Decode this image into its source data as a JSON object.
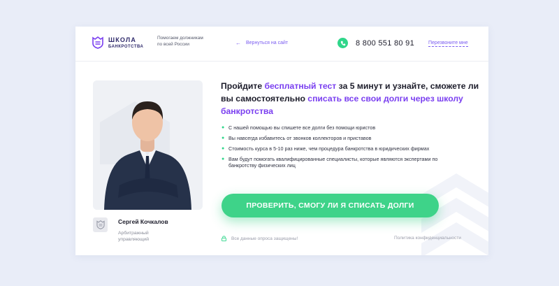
{
  "header": {
    "logo": {
      "line1": "ШКОЛА",
      "line2": "БАНКРОТСТВА",
      "icon": "crown-shield-icon"
    },
    "tagline": "Помогаем должникам по всей России",
    "back_link": "Вернуться на сайт",
    "phone": "8 800 551 80 91",
    "callback": "Перезвоните мне"
  },
  "headline": {
    "part1": "Пройдите ",
    "accent1": "бесплатный тест",
    "part2": " за 5 минут и узнайте, сможете ли вы самостоятельно ",
    "accent2": "списать все свои долги через школу банкротства"
  },
  "bullets": [
    "С нашей помощью вы спишете все долги без помощи юристов",
    "Вы навсегда избавитесь от звонков коллекторов и приставов",
    "Стоимость курса в 5-10 раз ниже, чем процедура банкротства в юридических фирмах",
    "Вам будут помогать квалифицированные специалисты, которые являются экспертами по банкротству физических лиц"
  ],
  "cta": "ПРОВЕРИТЬ, СМОГУ ЛИ Я СПИСАТЬ ДОЛГИ",
  "expert": {
    "name": "Сергей Кочкалов",
    "role": "Арбитражный управляющий"
  },
  "footer": {
    "secure": "Все данные опроса защищены!",
    "privacy": "Политика конфиденциальности"
  },
  "colors": {
    "accent": "#7a3ff0",
    "cta": "#3ed389",
    "background": "#e9edf8"
  }
}
